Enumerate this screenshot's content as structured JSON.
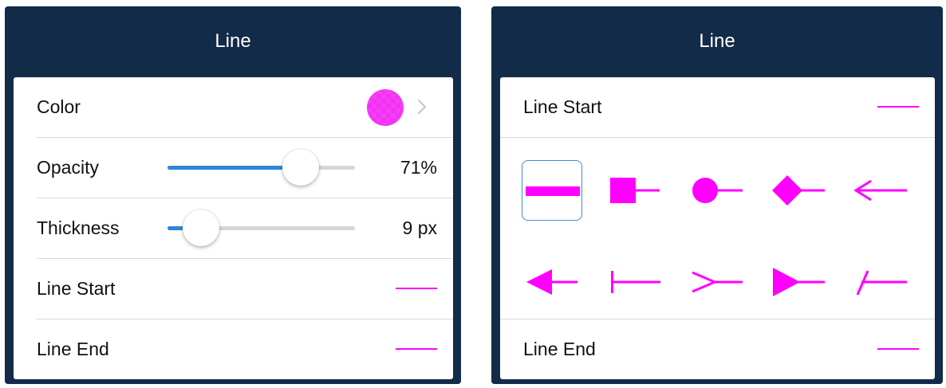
{
  "colors": {
    "nav_bg": "#122b49",
    "accent": "#ff00ff",
    "slider_fill": "#2f86d6",
    "selection": "#3d8bd9"
  },
  "left_panel": {
    "title": "Line",
    "rows": {
      "color": {
        "label": "Color",
        "swatch_color": "#ff00ff",
        "chevron_icon": "chevron-right-icon"
      },
      "opacity": {
        "label": "Opacity",
        "value": "71%",
        "level": 0.71
      },
      "thickness": {
        "label": "Thickness",
        "value": "9 px",
        "level": 0.18
      },
      "line_start": {
        "label": "Line Start",
        "preview": "plain-line"
      },
      "line_end": {
        "label": "Line End",
        "preview": "plain-line"
      }
    }
  },
  "right_panel": {
    "title": "Line",
    "line_start": {
      "label": "Line Start",
      "preview": "plain-line"
    },
    "line_end": {
      "label": "Line End",
      "preview": "plain-line"
    },
    "styles": [
      {
        "name": "line-style-none-icon",
        "selected": true
      },
      {
        "name": "line-style-square-icon",
        "selected": false
      },
      {
        "name": "line-style-circle-icon",
        "selected": false
      },
      {
        "name": "line-style-diamond-icon",
        "selected": false
      },
      {
        "name": "line-style-open-arrow-icon",
        "selected": false
      },
      {
        "name": "line-style-closed-arrow-icon",
        "selected": false
      },
      {
        "name": "line-style-butt-icon",
        "selected": false
      },
      {
        "name": "line-style-reverse-open-arrow-icon",
        "selected": false
      },
      {
        "name": "line-style-reverse-closed-arrow-icon",
        "selected": false
      },
      {
        "name": "line-style-slash-icon",
        "selected": false
      }
    ]
  }
}
